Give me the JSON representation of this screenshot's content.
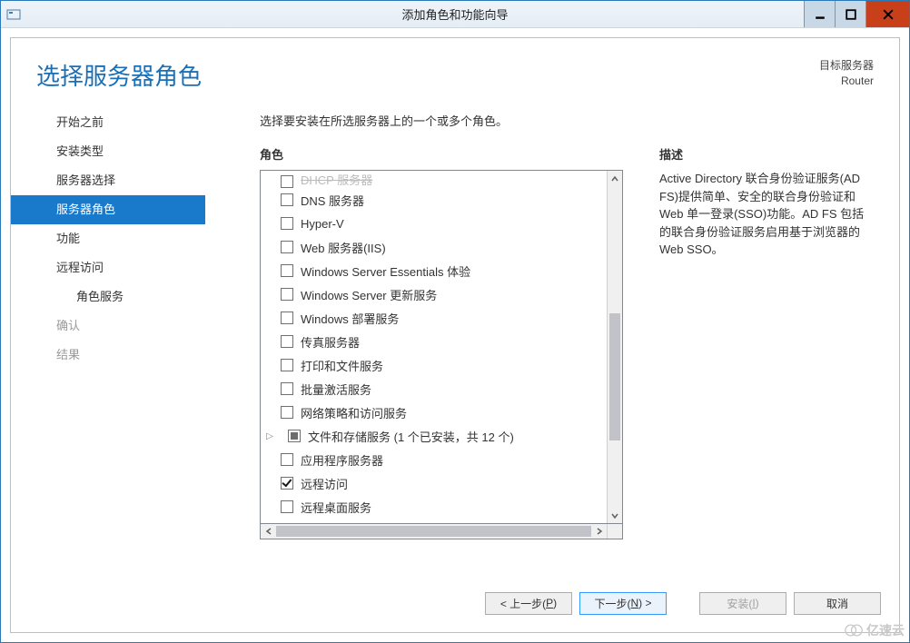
{
  "window": {
    "title": "添加角色和功能向导"
  },
  "header": {
    "page_title": "选择服务器角色",
    "target_label": "目标服务器",
    "target_value": "Router"
  },
  "nav": {
    "items": [
      {
        "label": "开始之前"
      },
      {
        "label": "安装类型"
      },
      {
        "label": "服务器选择"
      },
      {
        "label": "服务器角色"
      },
      {
        "label": "功能"
      },
      {
        "label": "远程访问"
      },
      {
        "label": "角色服务"
      },
      {
        "label": "确认"
      },
      {
        "label": "结果"
      }
    ]
  },
  "content": {
    "instruction": "选择要安装在所选服务器上的一个或多个角色。",
    "roles_label": "角色",
    "desc_label": "描述",
    "description": "Active Directory 联合身份验证服务(AD FS)提供简单、安全的联合身份验证和 Web 单一登录(SSO)功能。AD FS 包括的联合身份验证服务启用基于浏览器的 Web SSO。",
    "roles": [
      {
        "label": "DHCP 服务器",
        "state": "cutoff"
      },
      {
        "label": "DNS 服务器",
        "state": "unchecked"
      },
      {
        "label": "Hyper-V",
        "state": "unchecked"
      },
      {
        "label": "Web 服务器(IIS)",
        "state": "unchecked"
      },
      {
        "label": "Windows Server Essentials 体验",
        "state": "unchecked"
      },
      {
        "label": "Windows Server 更新服务",
        "state": "unchecked"
      },
      {
        "label": "Windows 部署服务",
        "state": "unchecked"
      },
      {
        "label": "传真服务器",
        "state": "unchecked"
      },
      {
        "label": "打印和文件服务",
        "state": "unchecked"
      },
      {
        "label": "批量激活服务",
        "state": "unchecked"
      },
      {
        "label": "网络策略和访问服务",
        "state": "unchecked"
      },
      {
        "label": "文件和存储服务 (1 个已安装，共 12 个)",
        "state": "partial",
        "expandable": true
      },
      {
        "label": "应用程序服务器",
        "state": "unchecked"
      },
      {
        "label": "远程访问",
        "state": "checked"
      },
      {
        "label": "远程桌面服务",
        "state": "unchecked"
      }
    ]
  },
  "footer": {
    "prev": "< 上一步(",
    "prev_hot": "P",
    "prev_end": ")",
    "next": "下一步(",
    "next_hot": "N",
    "next_end": ") >",
    "install": "安装(",
    "install_hot": "I",
    "install_end": ")",
    "cancel": "取消"
  },
  "watermark": "亿速云"
}
